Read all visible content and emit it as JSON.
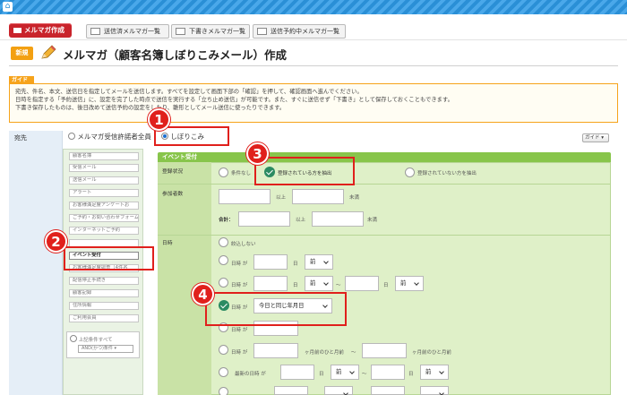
{
  "header": {
    "create_button": "メルマガ作成",
    "tabs": [
      {
        "label": "送信済メルマガ一覧"
      },
      {
        "label": "下書きメルマガ一覧"
      },
      {
        "label": "送信予約中メルマガ一覧"
      }
    ]
  },
  "heading": {
    "badge": "新規",
    "title": "メルマガ（顧客名簿しぼりこみメール）作成"
  },
  "guide": {
    "tag": "ガイド",
    "lines": [
      "宛先、件名、本文、送信日を指定してメールを送信します。すべてを設定して画面下部の「確認」を押して、確認画面へ進んでください。",
      "日時を指定する「予約送信」に、設定を完了した時点で送信を実行する「立ち止め送信」が可能です。また、すぐに送信せず「下書き」として保存しておくこともできます。",
      "下書き保存したものは、後日改めて送信予約の設定をしたり、雛形としてメール送信に使ったりできます。"
    ]
  },
  "destination": {
    "label": "宛先",
    "option_all": "メルマガ受信許諾者全員",
    "option_narrow": "しぼりこみ",
    "guide_button": "ガイド"
  },
  "filter_list": {
    "items": [
      "顧客名簿",
      "受信メール",
      "送信メール",
      "アラート",
      "お客様満足度アンケートお",
      "ご予約・お問い合わせフォーム",
      "インターネットご予約",
      "",
      "イベント受付",
      "お客様満足度調査（4件名",
      "配信停止手続き",
      "顧客記録",
      "住所情報",
      "ご利用会員"
    ],
    "any_label": "上記条件すべて",
    "any_select": "AND(かつ)条件"
  },
  "event_panel": {
    "title": "イベント受付",
    "status_label": "登録状況",
    "status_options": [
      "条件なし",
      "登録されている方を抽出",
      "登録されていない方を抽出"
    ],
    "participants_label": "参加者数",
    "above": "以上",
    "below": "未満",
    "total_label": "合計：",
    "datetime_label": "日時",
    "no_narrow": "絞込しない",
    "date_ga": "日時 が",
    "day_unit": "日",
    "before": "前",
    "today_option": "今日と同じ年月日",
    "month_start": "ヶ月前のひと月前",
    "month_end": "ヶ月前のひと月前",
    "latest_date": "最新の日時 が",
    "tilde": "〜"
  },
  "callouts": [
    "1",
    "2",
    "3",
    "4"
  ]
}
